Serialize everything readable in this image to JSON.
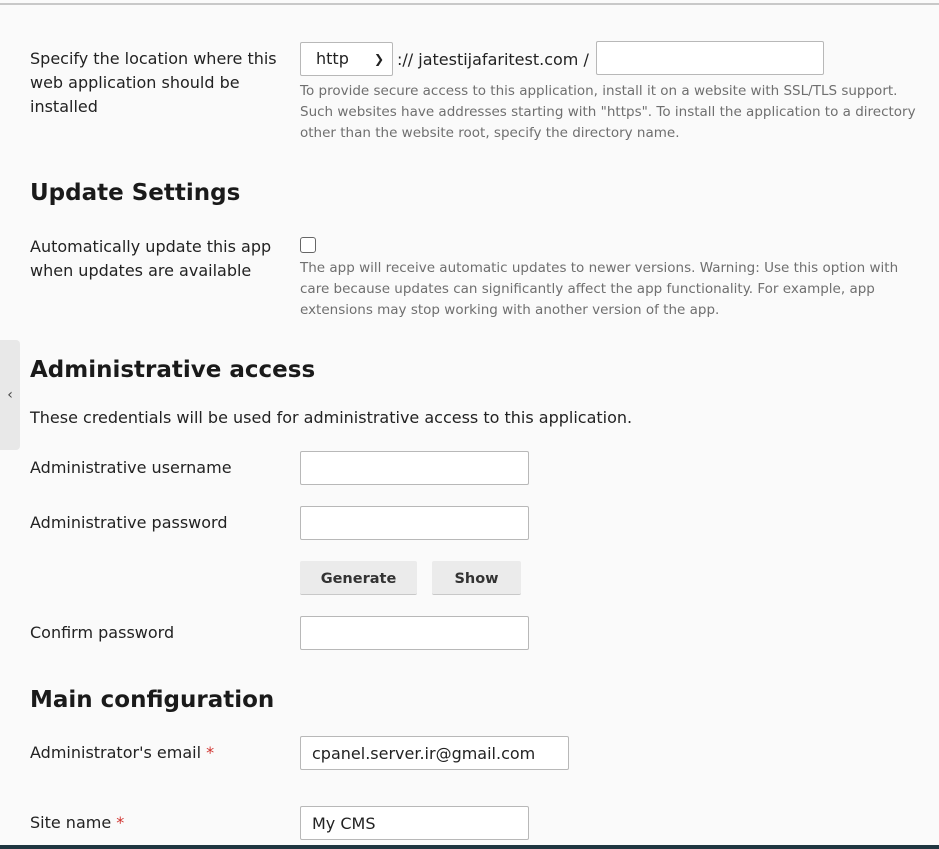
{
  "location": {
    "label": "Specify the location where this web application should be installed",
    "protocol_selected": "http",
    "domain": ":// jatestijafaritest.com /",
    "directory_value": "",
    "help": "To provide secure access to this application, install it on a website with SSL/TLS support. Such websites have addresses starting with \"https\". To install the application to a directory other than the website root, specify the directory name."
  },
  "update_settings": {
    "title": "Update Settings",
    "auto_update_label": "Automatically update this app when updates are available",
    "auto_update_checked": false,
    "help": "The app will receive automatic updates to newer versions. Warning: Use this option with care because updates can significantly affect the app functionality. For example, app extensions may stop working with another version of the app."
  },
  "admin_access": {
    "title": "Administrative access",
    "description": "These credentials will be used for administrative access to this application.",
    "username_label": "Administrative username",
    "username_value": "",
    "password_label": "Administrative password",
    "password_value": "",
    "generate_label": "Generate",
    "show_label": "Show",
    "confirm_label": "Confirm password",
    "confirm_value": ""
  },
  "main_config": {
    "title": "Main configuration",
    "email_label": "Administrator's email",
    "email_value": "cpanel.server.ir@gmail.com",
    "site_name_label": "Site name",
    "site_name_value": "My CMS",
    "required_mark": "*"
  },
  "sidebar_toggle": {
    "icon": "chevron-left-icon",
    "glyph": "‹"
  },
  "colors": {
    "required": "#d0312d",
    "bottom_bar": "#1f3640"
  }
}
